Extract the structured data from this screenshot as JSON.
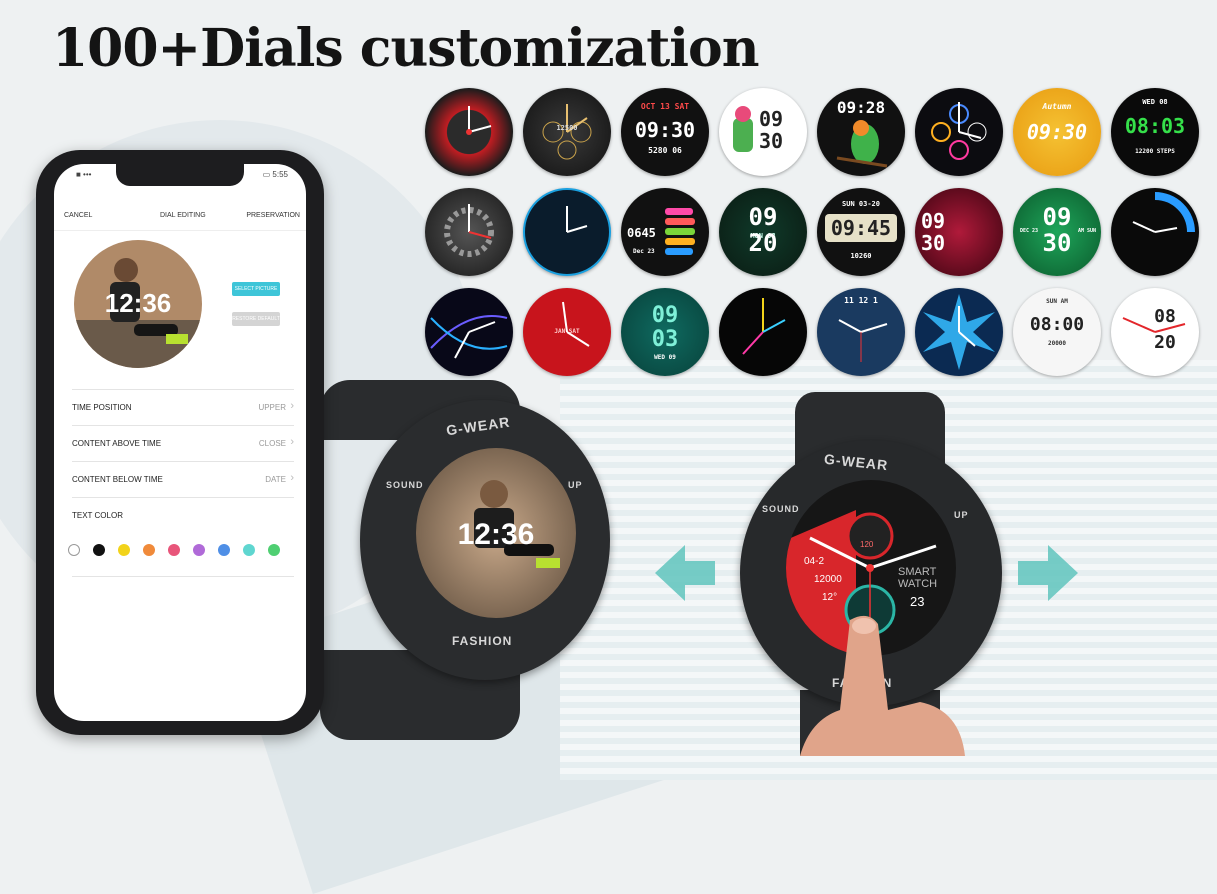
{
  "headline": "100+Dials customization",
  "dial_faces": [
    {
      "id": "r1c1",
      "text": ""
    },
    {
      "id": "r1c2",
      "text": "12500"
    },
    {
      "id": "r1c3",
      "text": "09:30",
      "top": "OCT 13 SAT",
      "bottom": "5280  06"
    },
    {
      "id": "r1c4",
      "text": "09 30",
      "bottom": "SAT 13"
    },
    {
      "id": "r1c5",
      "text": "09:28"
    },
    {
      "id": "r1c6",
      "text": ""
    },
    {
      "id": "r1c7",
      "text": "09:30",
      "top": "Autumn"
    },
    {
      "id": "r1c8",
      "text": "08:03",
      "top": "WED 08",
      "bottom": "12200 STEPS"
    },
    {
      "id": "r2c1",
      "text": ""
    },
    {
      "id": "r2c2",
      "text": ""
    },
    {
      "id": "r2c3",
      "text": "0645",
      "bottom": "Dec 23"
    },
    {
      "id": "r2c4",
      "text": "09 20",
      "top": "MON 08"
    },
    {
      "id": "r2c5",
      "text": "09:45",
      "top": "SUN 03-20",
      "bottom": "10260"
    },
    {
      "id": "r2c6",
      "text": "09 30"
    },
    {
      "id": "r2c7",
      "text": "09 30",
      "top": "DEC 23",
      "bottom": "AM SUN"
    },
    {
      "id": "r2c8",
      "text": ""
    },
    {
      "id": "r3c1",
      "text": ""
    },
    {
      "id": "r3c2",
      "text": "JAN  SAT"
    },
    {
      "id": "r3c3",
      "text": "09 03",
      "bottom": "WED 09"
    },
    {
      "id": "r3c4",
      "text": ""
    },
    {
      "id": "r3c5",
      "text": "11 12 1"
    },
    {
      "id": "r3c6",
      "text": ""
    },
    {
      "id": "r3c7",
      "text": "08:00",
      "top": "SUN AM",
      "bottom": "20000"
    },
    {
      "id": "r3c8",
      "text": "08 20"
    }
  ],
  "phone": {
    "status_left": "■ •••",
    "status_right": "▭ 5:55",
    "nav": {
      "cancel": "CANCEL",
      "title": "DIAL EDITING",
      "save": "PRESERVATION"
    },
    "preview_time": "12:36",
    "select_picture": "SELECT PICTURE",
    "restore_default": "RESTORE DEFAULT",
    "settings": [
      {
        "label": "TIME POSITION",
        "value": "UPPER"
      },
      {
        "label": "CONTENT ABOVE TIME",
        "value": "CLOSE"
      },
      {
        "label": "CONTENT BELOW TIME",
        "value": "DATE"
      }
    ],
    "text_color_label": "TEXT COLOR",
    "text_colors": [
      "#ffffff",
      "#111111",
      "#f2d31a",
      "#f08a3a",
      "#e8557a",
      "#b06ad8",
      "#4f8fe6",
      "#5fd6d0",
      "#4fcf72"
    ]
  },
  "watch_left": {
    "brand": "G-WEAR",
    "bottom": "FASHION",
    "left": "SOUND",
    "right": "UP",
    "time": "12:36"
  },
  "watch_right": {
    "brand": "G-WEAR",
    "bottom": "FASHION",
    "left": "SOUND",
    "right": "UP",
    "heart": "120",
    "date": "04-2",
    "steps": "12000",
    "temp": "12°",
    "label1": "SMART",
    "label2": "WATCH",
    "num": "23"
  },
  "colors": {
    "accent_teal": "#5fc4bd",
    "watch_red": "#d8262b"
  }
}
